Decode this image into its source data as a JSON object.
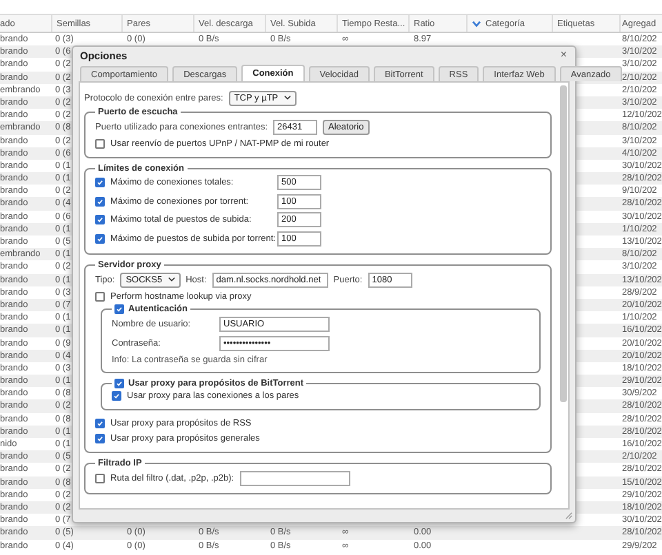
{
  "table": {
    "columns": [
      {
        "label": "ado",
        "sorted": false
      },
      {
        "label": "Semillas",
        "sorted": false
      },
      {
        "label": "Pares",
        "sorted": false
      },
      {
        "label": "Vel. descarga",
        "sorted": false
      },
      {
        "label": "Vel. Subida",
        "sorted": false
      },
      {
        "label": "Tiempo Resta...",
        "sorted": false
      },
      {
        "label": "Ratio",
        "sorted": false
      },
      {
        "label": "Categoría",
        "sorted": true
      },
      {
        "label": "Etiquetas",
        "sorted": false
      },
      {
        "label": "Agregad",
        "sorted": false
      }
    ],
    "rows": [
      {
        "status": "brando",
        "seeds": "0 (3)",
        "peers": "0 (0)",
        "down": "0 B/s",
        "up": "0 B/s",
        "eta": "∞",
        "ratio": "8.97",
        "added": "8/10/202"
      },
      {
        "status": "brando",
        "seeds": "0 (6",
        "added": "3/10/202"
      },
      {
        "status": "brando",
        "seeds": "0 (2",
        "added": "3/10/202"
      },
      {
        "status": "brando",
        "seeds": "0 (2",
        "added": "2/10/202"
      },
      {
        "status": "embrando",
        "seeds": "0 (3",
        "added": "2/10/202"
      },
      {
        "status": "brando",
        "seeds": "0 (2",
        "added": "3/10/202"
      },
      {
        "status": "brando",
        "seeds": "0 (2",
        "added": "12/10/202"
      },
      {
        "status": "embrando",
        "seeds": "0 (8",
        "added": "8/10/202"
      },
      {
        "status": "brando",
        "seeds": "0 (2",
        "added": "3/10/202"
      },
      {
        "status": "brando",
        "seeds": "0 (6",
        "added": "4/10/202"
      },
      {
        "status": "brando",
        "seeds": "0 (1",
        "added": "30/10/202"
      },
      {
        "status": "brando",
        "seeds": "0 (1",
        "added": "28/10/202"
      },
      {
        "status": "brando",
        "seeds": "0 (2",
        "added": "9/10/202"
      },
      {
        "status": "brando",
        "seeds": "0 (4",
        "added": "28/10/202"
      },
      {
        "status": "brando",
        "seeds": "0 (6",
        "added": "30/10/202"
      },
      {
        "status": "brando",
        "seeds": "0 (1",
        "added": "1/10/202"
      },
      {
        "status": "brando",
        "seeds": "0 (5",
        "added": "13/10/202"
      },
      {
        "status": "embrando",
        "seeds": "0 (1",
        "added": "8/10/202"
      },
      {
        "status": "brando",
        "seeds": "0 (2",
        "added": "3/10/202"
      },
      {
        "status": "brando",
        "seeds": "0 (1",
        "added": "13/10/202"
      },
      {
        "status": "brando",
        "seeds": "0 (3",
        "added": "28/9/202"
      },
      {
        "status": "brando",
        "seeds": "0 (7",
        "added": "20/10/202"
      },
      {
        "status": "brando",
        "seeds": "0 (1",
        "added": "1/10/202"
      },
      {
        "status": "brando",
        "seeds": "0 (1",
        "added": "16/10/202"
      },
      {
        "status": "brando",
        "seeds": "0 (9",
        "added": "20/10/202"
      },
      {
        "status": "brando",
        "seeds": "0 (4",
        "added": "20/10/202"
      },
      {
        "status": "brando",
        "seeds": "0 (3",
        "added": "18/10/202"
      },
      {
        "status": "brando",
        "seeds": "0 (1",
        "added": "29/10/202"
      },
      {
        "status": "brando",
        "seeds": "0 (8",
        "added": "30/9/202"
      },
      {
        "status": "brando",
        "seeds": "0 (2",
        "added": "28/10/202"
      },
      {
        "status": "brando",
        "seeds": "0 (8",
        "added": "28/10/202"
      },
      {
        "status": "brando",
        "seeds": "0 (1",
        "added": "28/10/202"
      },
      {
        "status": "nido",
        "seeds": "0 (1",
        "added": "16/10/202"
      },
      {
        "status": "brando",
        "seeds": "0 (5",
        "added": "2/10/202"
      },
      {
        "status": "brando",
        "seeds": "0 (2",
        "added": "28/10/202"
      },
      {
        "status": "brando",
        "seeds": "0 (8",
        "added": "15/10/202"
      },
      {
        "status": "brando",
        "seeds": "0 (2",
        "added": "29/10/202"
      },
      {
        "status": "brando",
        "seeds": "0 (2",
        "added": "18/10/202"
      },
      {
        "status": "brando",
        "seeds": "0 (7",
        "added": "30/10/202"
      },
      {
        "status": "brando",
        "seeds": "0 (5)",
        "peers": "0 (0)",
        "down": "0 B/s",
        "up": "0 B/s",
        "eta": "∞",
        "ratio": "0.00",
        "added": "28/10/202"
      },
      {
        "status": "brando",
        "seeds": "0 (4)",
        "peers": "0 (0)",
        "down": "0 B/s",
        "up": "0 B/s",
        "eta": "∞",
        "ratio": "0.00",
        "added": "29/9/202"
      }
    ]
  },
  "dialog": {
    "title": "Opciones",
    "close": "×",
    "tabs": [
      {
        "label": "Comportamiento",
        "selected": false
      },
      {
        "label": "Descargas",
        "selected": false
      },
      {
        "label": "Conexión",
        "selected": true
      },
      {
        "label": "Velocidad",
        "selected": false
      },
      {
        "label": "BitTorrent",
        "selected": false
      },
      {
        "label": "RSS",
        "selected": false
      },
      {
        "label": "Interfaz Web",
        "selected": false
      },
      {
        "label": "Avanzado",
        "selected": false
      }
    ],
    "protocol": {
      "label": "Protocolo de conexión entre pares:",
      "value": "TCP y µTP"
    },
    "listening_port": {
      "title": "Puerto de escucha",
      "port_label": "Puerto utilizado para conexiones entrantes:",
      "port": "26431",
      "random_button": "Aleatorio",
      "upnp": {
        "label": "Usar reenvío de puertos UPnP / NAT-PMP de mi router",
        "checked": false
      }
    },
    "connection_limits": {
      "title": "Límites de conexión",
      "items": [
        {
          "label": "Máximo de conexiones totales:",
          "checked": true,
          "value": "500"
        },
        {
          "label": "Máximo de conexiones por torrent:",
          "checked": true,
          "value": "100"
        },
        {
          "label": "Máximo total de puestos de subida:",
          "checked": true,
          "value": "200"
        },
        {
          "label": "Máximo de puestos de subida por torrent:",
          "checked": true,
          "value": "100"
        }
      ]
    },
    "proxy": {
      "title": "Servidor proxy",
      "type_label": "Tipo:",
      "type": "SOCKS5",
      "host_label": "Host:",
      "host": "dam.nl.socks.nordhold.net",
      "port_label": "Puerto:",
      "port": "1080",
      "hostname_lookup": {
        "label": "Perform hostname lookup via proxy",
        "checked": false
      },
      "authentication": {
        "label": "Autenticación",
        "checked": true,
        "username_label": "Nombre de usuario:",
        "username": "USUARIO",
        "password_label": "Contraseña:",
        "password": "•••••••••••••••",
        "info": "Info: La contraseña se guarda sin cifrar"
      },
      "bittorrent": {
        "label": "Usar proxy para propósitos de BitTorrent",
        "checked": true,
        "peer_connections": {
          "label": "Usar proxy para las conexiones a los pares",
          "checked": true
        }
      },
      "rss": {
        "label": "Usar proxy para propósitos de RSS",
        "checked": true
      },
      "general": {
        "label": "Usar proxy para propósitos generales",
        "checked": true
      }
    },
    "ip_filter": {
      "title": "Filtrado IP",
      "filter": {
        "label": "Ruta del filtro (.dat, .p2p, .p2b):",
        "checked": false
      }
    }
  }
}
